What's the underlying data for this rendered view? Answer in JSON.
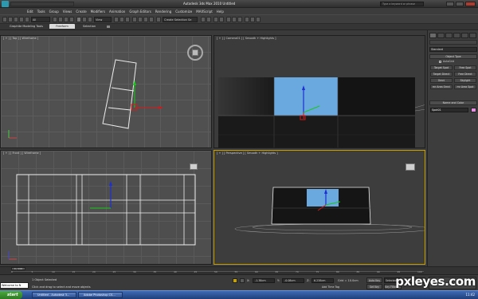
{
  "window": {
    "title": "Autodesk 3ds Max  2010      Untitled",
    "search_placeholder": "Type a keyword or phrase"
  },
  "menu": [
    "Edit",
    "Tools",
    "Group",
    "Views",
    "Create",
    "Modifiers",
    "Animation",
    "Graph Editors",
    "Rendering",
    "Customize",
    "MAXScript",
    "Help"
  ],
  "toolbar": {
    "filter": "All",
    "refcoord": "View",
    "selset": "Create Selection Se"
  },
  "ribbon": {
    "tabs": [
      "Graphite Modeling Tools",
      "Freeform",
      "Selection"
    ]
  },
  "viewports": {
    "top": "[ + ] [ Top ] [ Wireframe ]",
    "camera": "[ + ] [ Camera01 ] [ Smooth + Highlights ]",
    "front": "[ + ] [ Front ] [ Wireframe ]",
    "persp": "[ + ] [ Perspective ] [ Smooth + Highlights ]"
  },
  "command_panel": {
    "category": "Standard",
    "rollout_object_type": "Object Type",
    "autogrid": "AutoGrid",
    "buttons": [
      "Target Spot",
      "Free Spot",
      "Target Direct",
      "Free Direct",
      "Omni",
      "Skylight",
      "mr Area Omni",
      "mr Area Spot"
    ],
    "rollout_name_color": "Name and Color",
    "object_name": "Spot01"
  },
  "timeline": {
    "frame": "0 / 100",
    "ticks": [
      "0",
      "5",
      "10",
      "15",
      "20",
      "25",
      "30",
      "35",
      "40",
      "45",
      "50",
      "55",
      "60",
      "65",
      "70",
      "75",
      "80",
      "85",
      "90",
      "95",
      "100"
    ]
  },
  "status": {
    "listener": "Welcome to N",
    "selected": "1 Object Selected",
    "prompt": "Click and drag to select and move objects",
    "x": "-1.38cm",
    "y": "-0.08cm",
    "z": "6.238cm",
    "grid": "Grid = 10.0cm",
    "autokey": "Auto Key",
    "setkey": "Set Key",
    "selected_mode": "Selected",
    "keyfilters": "Key Filters...",
    "add_time_tag": "Add Time Tag"
  },
  "taskbar": {
    "start": "start",
    "tasks": [
      "Untitled - Autodesk 3...",
      "Adobe Photoshop CS..."
    ],
    "clock": "11:42"
  },
  "watermark": "pxleyes.com"
}
